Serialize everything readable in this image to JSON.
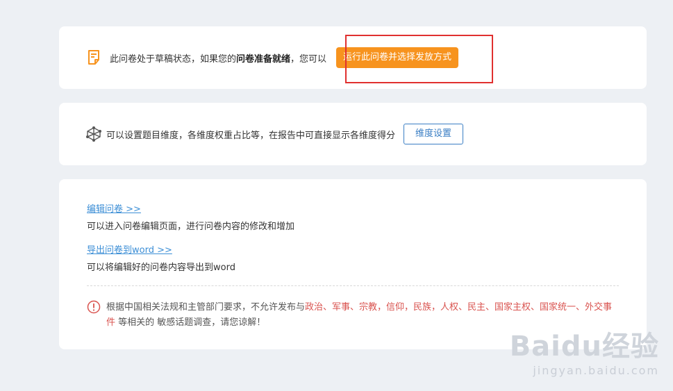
{
  "draft": {
    "text_prefix": "此问卷处于草稿状态，如果您的",
    "text_bold": "问卷准备就绪",
    "text_suffix": "，您可以",
    "run_button": "运行此问卷并选择发放方式",
    "icon": "draft-note-icon"
  },
  "dimension": {
    "text": "可以设置题目维度，各维度权重占比等，在报告中可直接显示各维度得分",
    "button": "维度设置",
    "icon": "dimension-network-icon"
  },
  "actions": {
    "edit_link": "编辑问卷 >>",
    "edit_desc": "可以进入问卷编辑页面，进行问卷内容的修改和增加",
    "export_link": "导出问卷到word >>",
    "export_desc": "可以将编辑好的问卷内容导出到word"
  },
  "notice": {
    "icon": "warning-circle-icon",
    "part1": "根据中国相关法规和主管部门要求，不允许发布与",
    "topics": "政治、军事、宗教，信仰，民族，人权、民主、国家主权、国家统一、外交事件",
    "part2": " 等相关的 敏感话题调查，请您谅解！"
  },
  "watermark": {
    "logo": "Baidu经验",
    "url": "jingyan.baidu.com"
  },
  "colors": {
    "orange": "#f7931e",
    "blue": "#3a7ec4",
    "link": "#3b8ed6",
    "red": "#d9534f",
    "highlight": "#e0302f"
  }
}
